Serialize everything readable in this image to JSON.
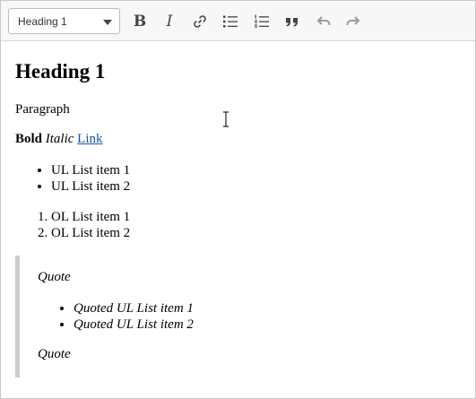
{
  "toolbar": {
    "heading_select": "Heading 1",
    "buttons": {
      "bold": "B",
      "italic": "I"
    }
  },
  "content": {
    "heading": "Heading 1",
    "paragraph": "Paragraph",
    "bold": "Bold",
    "italic": "Italic",
    "link": "Link",
    "ul_items": [
      "UL List item 1",
      "UL List item 2"
    ],
    "ol_items": [
      "OL List item 1",
      "OL List item 2"
    ],
    "quote": {
      "text_top": "Quote",
      "items": [
        "Quoted UL List item 1",
        "Quoted UL List item 2"
      ],
      "text_bottom": "Quote"
    }
  },
  "icons": [
    "chevron-down-icon",
    "link-icon",
    "bulleted-list-icon",
    "numbered-list-icon",
    "blockquote-icon",
    "undo-icon",
    "redo-icon",
    "text-cursor-icon"
  ],
  "colors": {
    "toolbar_bg": "#f7f7f7",
    "link": "#1a55a6",
    "quote_border": "#cccccc",
    "disabled_icon": "#9c9c9c"
  }
}
